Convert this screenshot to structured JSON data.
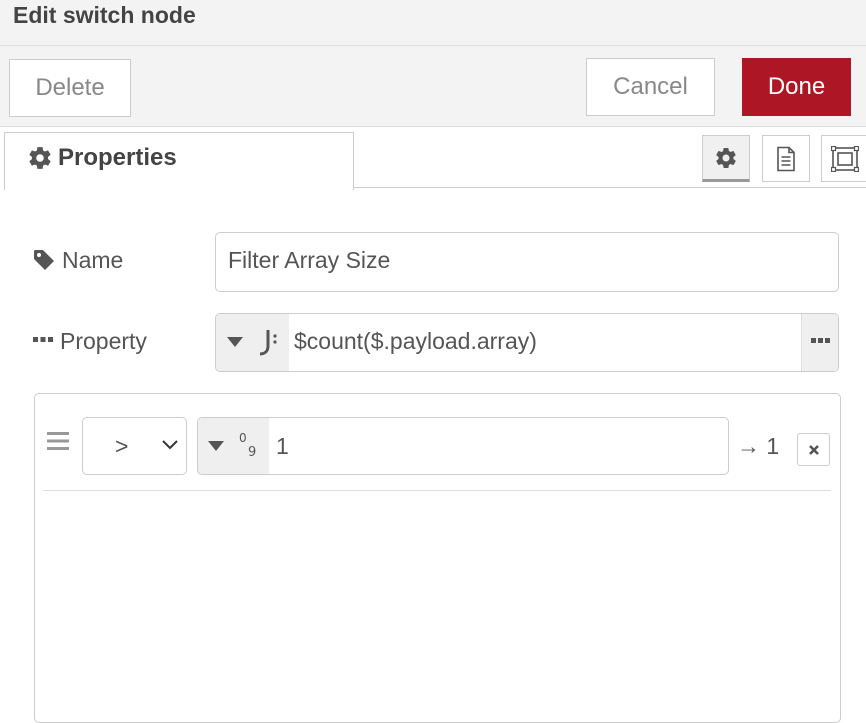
{
  "dialog": {
    "title": "Edit switch node"
  },
  "toolbar": {
    "delete_label": "Delete",
    "cancel_label": "Cancel",
    "done_label": "Done"
  },
  "tabs": [
    {
      "label": "Properties",
      "icon": "gear-icon",
      "active": true
    }
  ],
  "side_buttons": [
    {
      "name": "node-settings-button",
      "icon": "gear-icon",
      "active": true
    },
    {
      "name": "node-description-button",
      "icon": "document-icon"
    },
    {
      "name": "node-appearance-button",
      "icon": "frame-icon"
    }
  ],
  "form": {
    "name": {
      "label": "Name",
      "icon": "tag-icon",
      "value": "Filter Array Size"
    },
    "property": {
      "label": "Property",
      "icon": "ellipsis-icon",
      "type_icon": "jsonata-icon",
      "value": "$count($.payload.array)"
    }
  },
  "rules": [
    {
      "operator": ">",
      "value_type_icon": "number-type-icon",
      "value": "1",
      "output": "→ 1"
    }
  ],
  "colors": {
    "accent": "#ad1625",
    "header_bg": "#f3f3f3",
    "border": "#cccccc",
    "text": "#555555"
  }
}
